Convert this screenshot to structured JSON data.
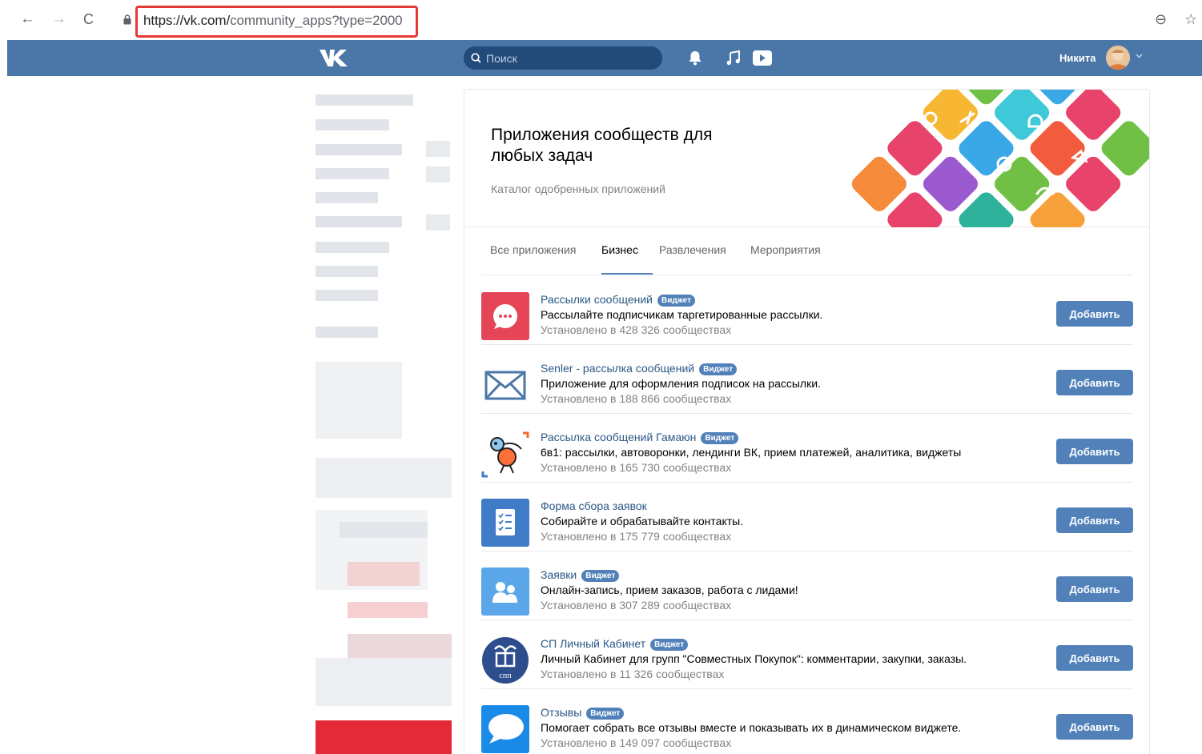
{
  "browser": {
    "url_prefix": "https://vk.com/",
    "url_path": "community_apps?type=2000",
    "back": "←",
    "forward": "→",
    "reload": "C",
    "zoom": "⊖",
    "star": "☆"
  },
  "header": {
    "search_placeholder": "Поиск",
    "user_name": "Никита"
  },
  "hero": {
    "title": "Приложения сообществ для любых задач",
    "subtitle": "Каталог одобренных приложений"
  },
  "tabs": [
    {
      "label": "Все приложения"
    },
    {
      "label": "Бизнес",
      "active": true
    },
    {
      "label": "Развлечения"
    },
    {
      "label": "Мероприятия"
    }
  ],
  "badge_label": "Виджет",
  "add_label": "Добавить",
  "apps": [
    {
      "title": "Рассылки сообщений",
      "widget": true,
      "desc": "Рассылайте подписчикам таргетированные рассылки.",
      "installs": "Установлено в 428 326 сообществах",
      "icon": "chat-bubble-icon",
      "color": "#e64557"
    },
    {
      "title": "Senler - рассылка сообщений",
      "widget": true,
      "desc": "Приложение для оформления подписок на рассылки.",
      "installs": "Установлено в 188 866 сообществах",
      "icon": "envelope-icon",
      "color": "#4a76a8"
    },
    {
      "title": "Рассылка сообщений Гамаюн",
      "widget": true,
      "desc": "6в1: рассылки, автоворонки, лендинги ВК, прием платежей, аналитика, виджеты",
      "installs": "Установлено в 165 730 сообществах",
      "icon": "bird-icon",
      "color": "#ff6f3b"
    },
    {
      "title": "Форма сбора заявок",
      "widget": false,
      "desc": "Собирайте и обрабатывайте контакты.",
      "installs": "Установлено в 175 779 сообществах",
      "icon": "form-checklist-icon",
      "color": "#3f7bc6"
    },
    {
      "title": "Заявки",
      "widget": true,
      "desc": "Онлайн-запись, прием заказов, работа с лидами!",
      "installs": "Установлено в 307 289 сообществах",
      "icon": "users-icon",
      "color": "#5aa6e8"
    },
    {
      "title": "СП Личный Кабинет",
      "widget": true,
      "desc": "Личный Кабинет для групп \"Совместных Покупок\": комментарии, закупки, заказы.",
      "installs": "Установлено в 11 326 сообществах",
      "icon": "gift-box-icon",
      "color": "#2d4d8c",
      "icon_text": "спп"
    },
    {
      "title": "Отзывы",
      "widget": true,
      "desc": "Помогает собрать все отзывы вместе и показывать их в динамическом виджете.",
      "installs": "Установлено в 149 097 сообществах",
      "icon": "speech-bubble-icon",
      "color": "#1a8ae8"
    }
  ]
}
